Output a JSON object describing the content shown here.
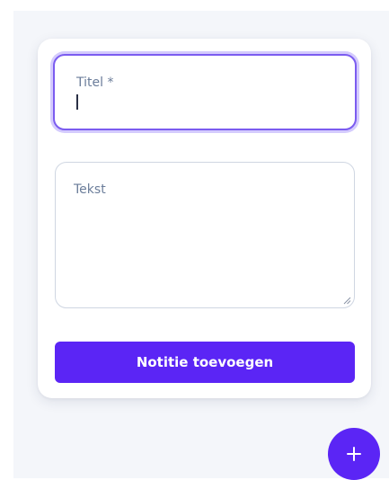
{
  "form": {
    "title_label": "Titel *",
    "title_value": "",
    "text_label": "Tekst",
    "text_value": "",
    "submit_label": "Notitie toevoegen"
  },
  "fab": {
    "icon": "plus-icon"
  },
  "colors": {
    "accent": "#5b25f5",
    "focus_ring": "#7b5cf0",
    "label": "#6b7d9a",
    "background": "#f4f6fa"
  }
}
